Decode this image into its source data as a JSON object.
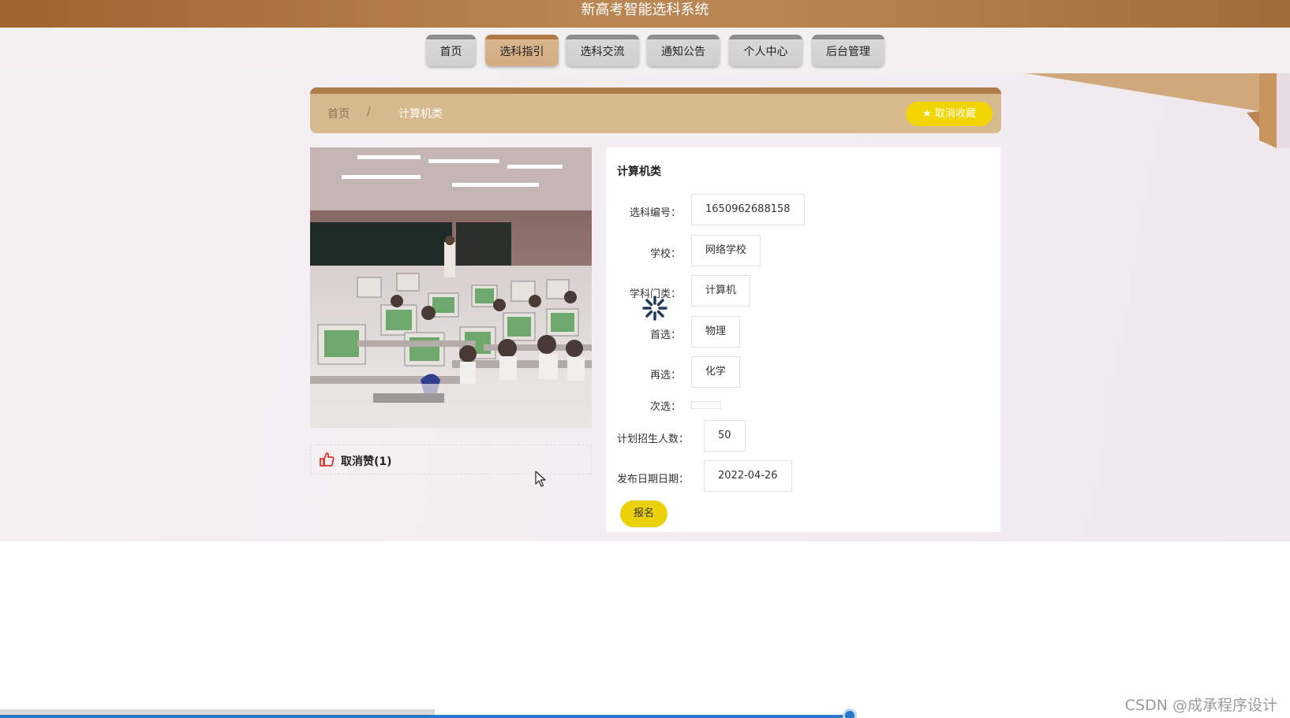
{
  "header": {
    "title": "新高考智能选科系统"
  },
  "nav": {
    "items": [
      {
        "label": "首页"
      },
      {
        "label": "选科指引",
        "active": true
      },
      {
        "label": "选科交流"
      },
      {
        "label": "通知公告"
      },
      {
        "label": "个人中心"
      },
      {
        "label": "后台管理"
      }
    ]
  },
  "breadcrumb": {
    "home": "首页",
    "separator": "/",
    "current": "计算机类"
  },
  "favorite": {
    "label": "取消收藏",
    "icon": "star-icon"
  },
  "like": {
    "label": "取消赞(1)",
    "icon": "thumbs-up-icon"
  },
  "detail": {
    "title": "计算机类",
    "fields": [
      {
        "label": "选科编号：",
        "value": "1650962688158"
      },
      {
        "label": "学校：",
        "value": "网络学校"
      },
      {
        "label": "学科门类：",
        "value": "计算机"
      },
      {
        "label": "首选：",
        "value": "物理"
      },
      {
        "label": "再选：",
        "value": "化学"
      },
      {
        "label": "次选：",
        "value": ""
      },
      {
        "label": "计划招生人数：",
        "value": "50"
      },
      {
        "label": "发布日期日期：",
        "value": "2022-04-26"
      }
    ],
    "signup_label": "报名"
  },
  "footer": {
    "watermark": "CSDN @成承程序设计"
  },
  "colors": {
    "accent": "#b07c47",
    "button": "#f2d500"
  }
}
